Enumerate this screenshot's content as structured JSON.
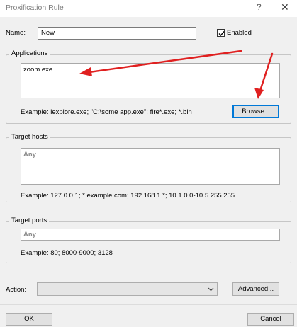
{
  "window": {
    "title": "Proxification Rule",
    "help_glyph": "?",
    "close_glyph": "✕"
  },
  "name_field": {
    "label": "Name:",
    "value": "New"
  },
  "enabled": {
    "label": "Enabled",
    "checked": true
  },
  "applications": {
    "group_title": "Applications",
    "value": "zoom.exe",
    "example": "Example: iexplore.exe; \"C:\\some app.exe\"; fire*.exe; *.bin",
    "browse_label": "Browse..."
  },
  "target_hosts": {
    "group_title": "Target hosts",
    "value": "Any",
    "example": "Example: 127.0.0.1; *.example.com; 192.168.1.*; 10.1.0.0-10.5.255.255"
  },
  "target_ports": {
    "group_title": "Target ports",
    "value": "Any",
    "example": "Example: 80; 8000-9000; 3128"
  },
  "action": {
    "label": "Action:",
    "selected": "",
    "advanced_label": "Advanced..."
  },
  "footer": {
    "ok_label": "OK",
    "cancel_label": "Cancel"
  },
  "colors": {
    "annotation_arrow": "#e02020",
    "focus": "#0078d7"
  }
}
